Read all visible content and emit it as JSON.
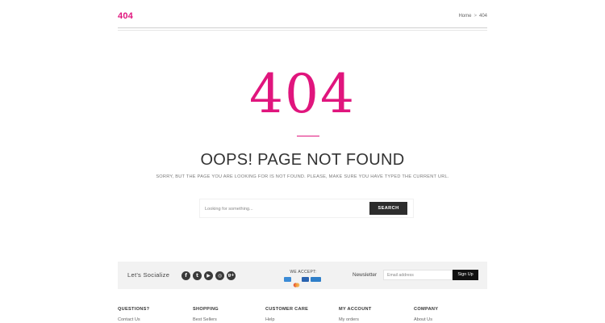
{
  "header": {
    "title": "404",
    "breadcrumb": [
      "Home",
      "404"
    ],
    "breadcrumb_separator": ">"
  },
  "main": {
    "big_code": "404",
    "heading": "OOPS! PAGE NOT FOUND",
    "subtext": "SORRY, BUT THE PAGE YOU ARE LOOKING FOR IS NOT FOUND. PLEASE, MAKE SURE YOU HAVE TYPED THE CURRENT URL.",
    "search": {
      "placeholder": "Looking for something...",
      "button_label": "SEARCH"
    }
  },
  "footer_band": {
    "social_label": "Let's Socialize",
    "social_icons": [
      "facebook-icon",
      "twitter-icon",
      "youtube-icon",
      "dribbble-icon",
      "google-plus-icon"
    ],
    "social_glyphs": [
      "f",
      "t",
      "▶",
      "◎",
      "g+"
    ],
    "accept_label": "WE ACCEPT:",
    "payment_icons": [
      "amex-card-icon",
      "mastercard-card-icon",
      "visa-card-icon",
      "paypal-card-icon"
    ],
    "newsletter_label": "Newsletter",
    "email_placeholder": "Email address",
    "signup_label": "Sign Up"
  },
  "footer_columns": [
    {
      "heading": "QUESTIONS?",
      "link": "Contact Us"
    },
    {
      "heading": "SHOPPING",
      "link": "Best Sellers"
    },
    {
      "heading": "CUSTOMER CARE",
      "link": "Help"
    },
    {
      "heading": "MY ACCOUNT",
      "link": "My orders"
    },
    {
      "heading": "COMPANY",
      "link": "About Us"
    }
  ],
  "colors": {
    "accent": "#e0157d",
    "dark_button": "#2d2d2d",
    "band_bg": "#f2f2f2",
    "payment": [
      "#3b8bd6",
      "#e8623a",
      "#2a63b0",
      "#2f7fc9"
    ]
  }
}
